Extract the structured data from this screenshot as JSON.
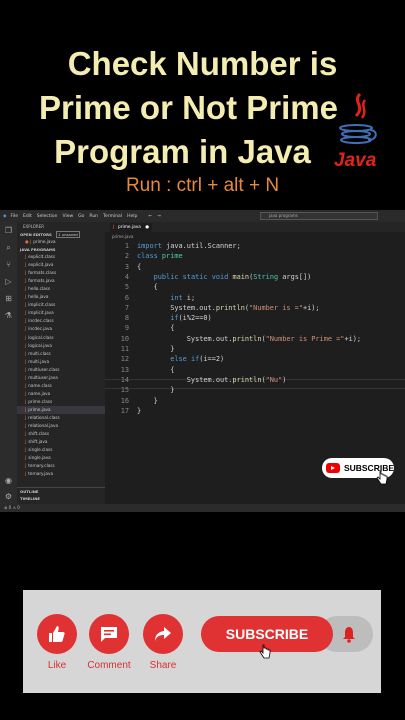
{
  "title": {
    "line1": "Check Number is",
    "line2": "Prime or Not Prime",
    "line3": "Program in Java"
  },
  "run_hint": "Run : ctrl + alt + N",
  "java_logo_text": "Java",
  "ide": {
    "menu": [
      "File",
      "Edit",
      "Selection",
      "View",
      "Go",
      "Run",
      "Terminal",
      "Help"
    ],
    "search_placeholder": "java programs",
    "explorer_label": "EXPLORER",
    "open_editors_label": "OPEN EDITORS",
    "open_editors_badge": "1 unsaved",
    "open_file": "prime.java",
    "folder_label": "JAVA PROGRAMS",
    "files": [
      "explicit.class",
      "explicit.java",
      "formats.class",
      "formats.java",
      "hello.class",
      "hello.java",
      "implicit.class",
      "implicit.java",
      "incdec.class",
      "incdec.java",
      "logical.class",
      "logical.java",
      "multi.class",
      "multi.java",
      "multiuser.class",
      "multiuser.java",
      "name.class",
      "name.java",
      "prime.class",
      "prime.java",
      "relational.class",
      "relational.java",
      "shift.class",
      "shift.java",
      "single.class",
      "single.java",
      "ternary.class",
      "ternary.java"
    ],
    "active_file": "prime.java",
    "outline_label": "OUTLINE",
    "timeline_label": "TIMELINE",
    "tab_label": "prime.java",
    "breadcrumb": "prime.java",
    "status_text": "⊗ 0 ⚠ 0",
    "line_numbers": [
      "1",
      "2",
      "3",
      "4",
      "5",
      "6",
      "7",
      "8",
      "9",
      "10",
      "11",
      "12",
      "13",
      "14",
      "15",
      "16",
      "17"
    ]
  },
  "subscribe_badge": "SUBSCRIBE",
  "card": {
    "like": "Like",
    "comment": "Comment",
    "share": "Share",
    "subscribe": "SUBSCRIBE"
  },
  "colors": {
    "accent_red": "#e03232",
    "title_yellow": "#f4ecb0",
    "run_orange": "#e58a3e"
  }
}
